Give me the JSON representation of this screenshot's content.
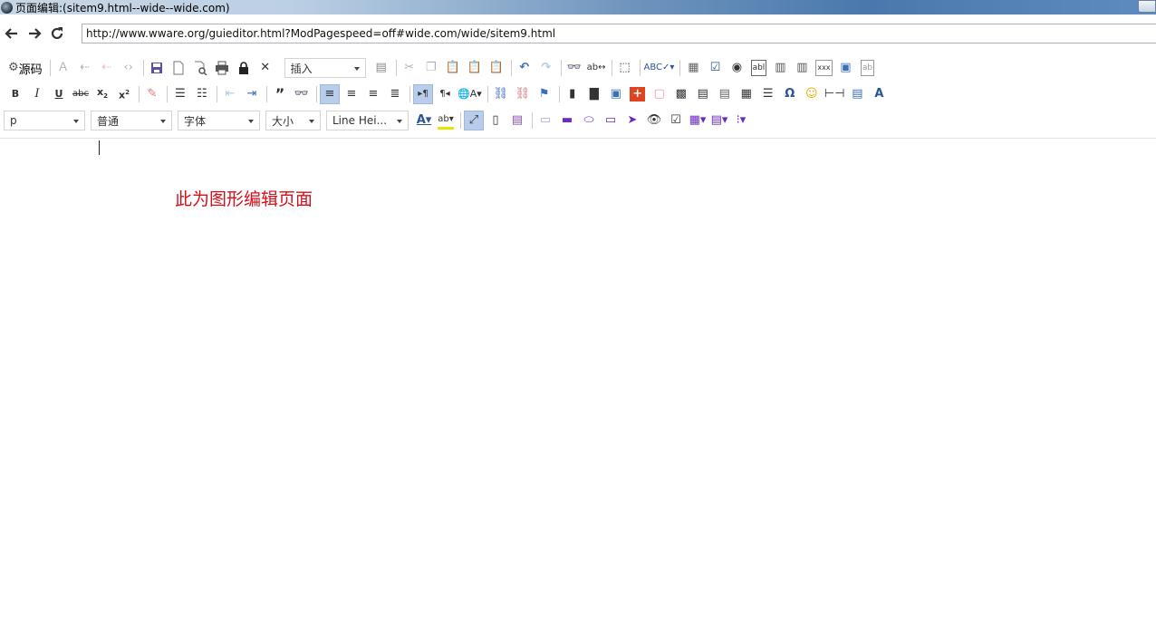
{
  "window": {
    "title": "页面编辑:(sitem9.html--wide--wide.com)"
  },
  "nav": {
    "url": "http://www.wware.org/guieditor.html?ModPagespeed=off#wide.com/wide/sitem9.html"
  },
  "toolbar": {
    "source_label": "源码",
    "insert_select": "插入",
    "format_select": "p",
    "paragraph_select": "普通",
    "font_select": "字体",
    "size_select": "大小",
    "lineheight_select": "Line Hei..."
  },
  "editor": {
    "content_text": "此为图形编辑页面"
  },
  "colors": {
    "content_text": "#d4101a",
    "active_button": "#b7cdeb"
  }
}
